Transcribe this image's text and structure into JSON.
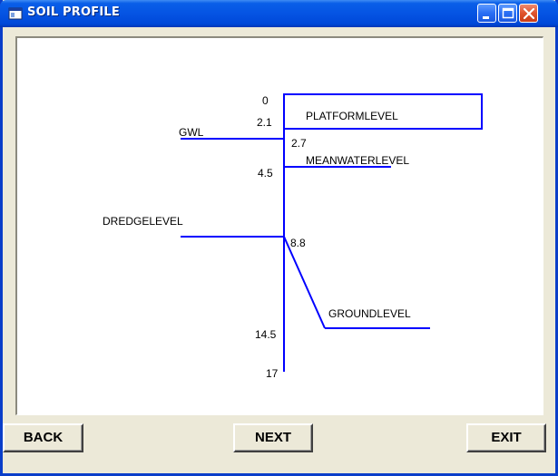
{
  "window": {
    "title": "SOIL PROFILE"
  },
  "profile": {
    "depth_labels": [
      "0",
      "2.1",
      "2.7",
      "4.5",
      "8.8",
      "14.5",
      "17"
    ],
    "level_labels": {
      "platform": "PLATFORMLEVEL",
      "gwl": "GWL",
      "meanwater": "MEANWATERLEVEL",
      "dredge": "DREDGELEVEL",
      "ground": "GROUNDLEVEL"
    },
    "line_color": "#0000ff"
  },
  "buttons": {
    "back": "BACK",
    "next": "NEXT",
    "exit": "EXIT"
  },
  "icons": [
    "window-app-icon",
    "minimize-icon",
    "maximize-icon",
    "close-icon"
  ]
}
